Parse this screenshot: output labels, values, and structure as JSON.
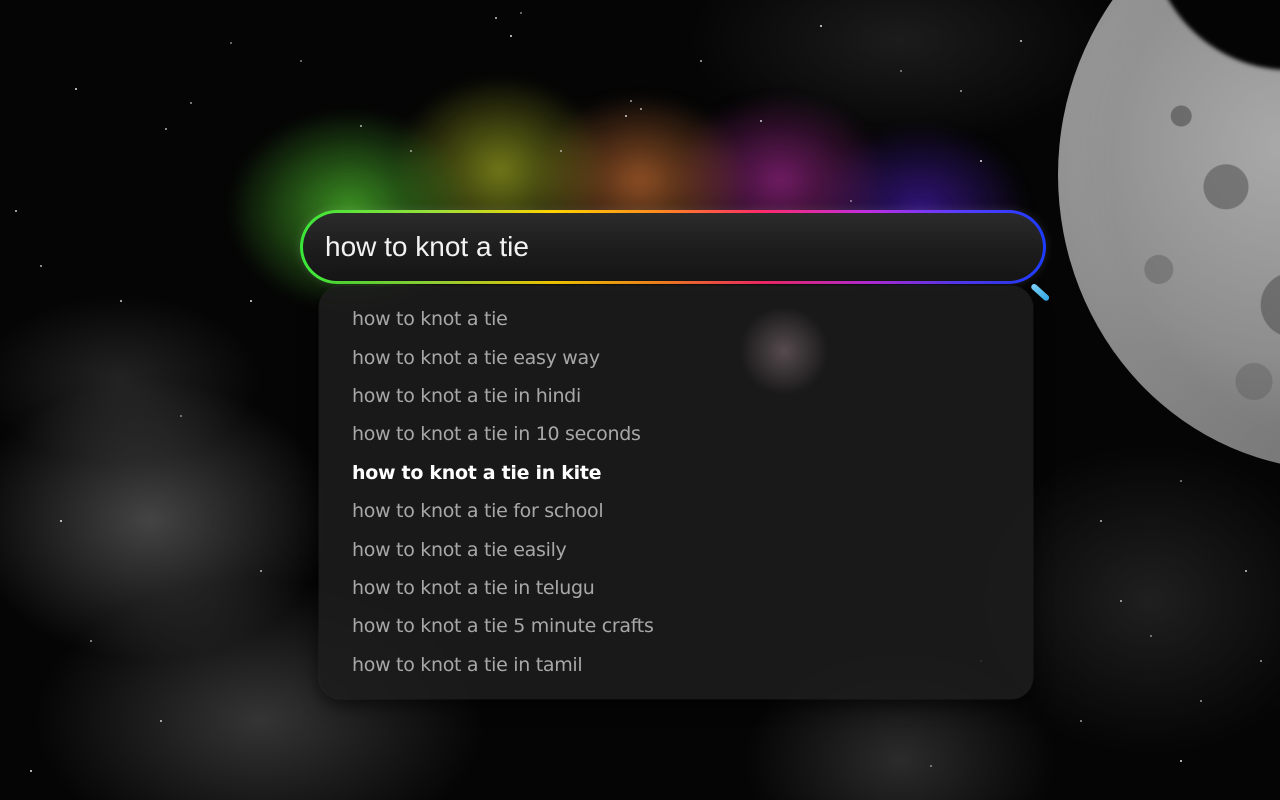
{
  "search": {
    "value": "how to knot a tie",
    "placeholder": ""
  },
  "suggestions": [
    {
      "text": "how to knot a tie"
    },
    {
      "text": "how to knot a tie easy way"
    },
    {
      "text": "how to knot a tie in hindi"
    },
    {
      "text": "how to knot a tie in 10 seconds"
    },
    {
      "text": "how to knot a tie in kite"
    },
    {
      "text": "how to knot a tie for school"
    },
    {
      "text": "how to knot a tie easily"
    },
    {
      "text": "how to knot a tie in telugu"
    },
    {
      "text": "how to knot a tie 5 minute crafts"
    },
    {
      "text": "how to knot a tie in tamil"
    }
  ],
  "active_suggestion_index": 4,
  "icons": {
    "search": "magnifier-handle-icon"
  },
  "colors": {
    "ring_gradient": [
      "#39e639",
      "#ffd200",
      "#ff8a1e",
      "#ff2a6a",
      "#c12de0",
      "#1d3cff"
    ],
    "handle": "#35a8e6",
    "text_primary": "#f2f2f2",
    "text_suggestion": "#a8a8a8",
    "text_active": "#ffffff"
  }
}
